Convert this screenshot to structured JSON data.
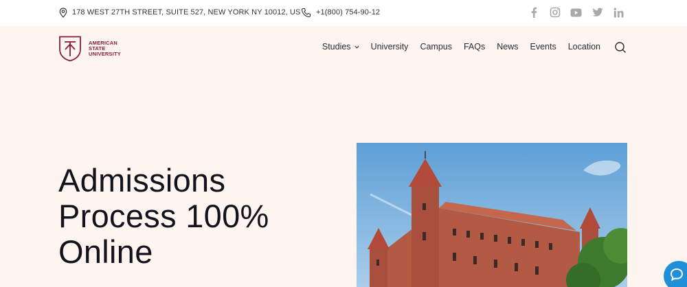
{
  "topbar": {
    "address": "178 WEST 27TH STREET, SUITE 527, NEW YORK NY 10012, US",
    "phone": "+1(800) 754-90-12",
    "social": [
      {
        "icon": "facebook-icon"
      },
      {
        "icon": "instagram-icon"
      },
      {
        "icon": "youtube-icon"
      },
      {
        "icon": "twitter-icon"
      },
      {
        "icon": "linkedin-icon"
      }
    ]
  },
  "logo": {
    "line1": "AMERICAN",
    "line2": "STATE",
    "line3": "UNIVERSITY"
  },
  "nav": {
    "items": [
      {
        "label": "Studies"
      },
      {
        "label": "University"
      },
      {
        "label": "Campus"
      },
      {
        "label": "FAQs"
      },
      {
        "label": "News"
      },
      {
        "label": "Events"
      },
      {
        "label": "Location"
      }
    ]
  },
  "hero": {
    "title_line1": "Admissions",
    "title_line2": "Process 100%",
    "title_line3": "Online"
  },
  "colors": {
    "brand": "#8b1b3a",
    "background": "#fef5f0",
    "chat": "#1f8fd8"
  }
}
